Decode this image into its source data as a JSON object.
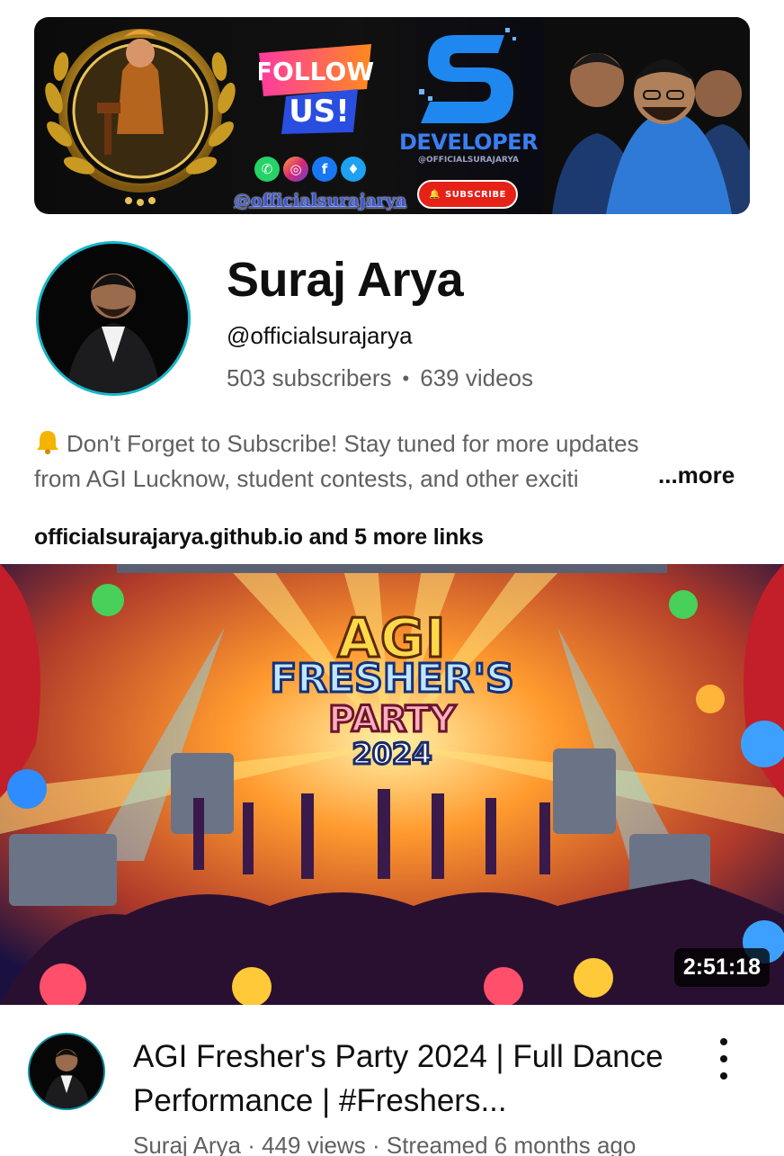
{
  "banner": {
    "follow_line1": "FOLLOW",
    "follow_line2": "US!",
    "handle": "@officialsurajarya",
    "developer_title": "DEVELOPER",
    "developer_handle": "@OFFICIALSURAJARYA",
    "subscribe_label": "SUBSCRIBE",
    "social_icons": [
      "whatsapp-icon",
      "instagram-icon",
      "facebook-icon",
      "twitter-icon"
    ]
  },
  "channel": {
    "name": "Suraj Arya",
    "handle": "@officialsurajarya",
    "subscribers": "503 subscribers",
    "separator": "•",
    "videos": "639 videos",
    "description_line1": "Don't Forget to Subscribe! Stay tuned for more updates",
    "description_line2": "from AGI Lucknow, student contests, and other exciti",
    "more_label": "...more",
    "links": "officialsurajarya.github.io and 5 more links",
    "accent_ring": "#17b5c9"
  },
  "video": {
    "thumbnail_line1": "AGI",
    "thumbnail_line2": "FRESHER'S",
    "thumbnail_line3": "PARTY",
    "thumbnail_line4": "2024",
    "duration": "2:51:18",
    "title": "AGI Fresher's Party 2024 | Full Dance Performance | #Freshers...",
    "author": "Suraj Arya",
    "views": "449 views",
    "streamed": "Streamed 6 months ago",
    "meta_separator": "·"
  }
}
